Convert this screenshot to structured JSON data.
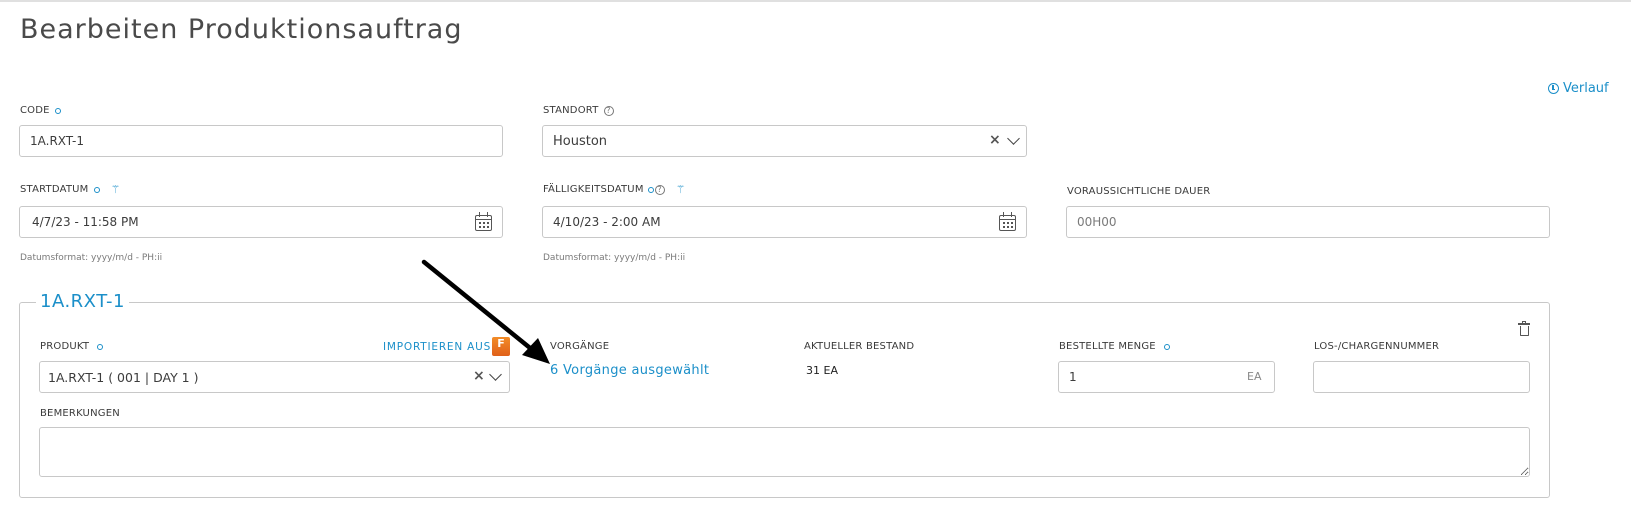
{
  "page_title": "Bearbeiten Produktionsauftrag",
  "history_link": "Verlauf",
  "fields": {
    "code": {
      "label": "CODE",
      "value": "1A.RXT-1"
    },
    "location": {
      "label": "STANDORT",
      "value": "Houston"
    },
    "start_date": {
      "label": "STARTDATUM",
      "value": "4/7/23 - 11:58 PM",
      "hint": "Datumsformat: yyyy/m/d - PH:ii"
    },
    "due_date": {
      "label": "FÄLLIGKEITSDATUM",
      "value": "4/10/23 - 2:00 AM",
      "hint": "Datumsformat: yyyy/m/d - PH:ii"
    },
    "expected_duration": {
      "label": "VORAUSSICHTLICHE DAUER",
      "placeholder": "00H00"
    }
  },
  "section": {
    "title": "1A.RXT-1",
    "product": {
      "label": "PRODUKT",
      "value": "1A.RXT-1 ( 001 | DAY 1 )",
      "import_label": "IMPORTIEREN AUS",
      "import_icon_letter": "F"
    },
    "operations": {
      "label": "VORGÄNGE",
      "value": "6 Vorgänge ausgewählt"
    },
    "current_stock": {
      "label": "AKTUELLER BESTAND",
      "value": "31 EA"
    },
    "ordered_qty": {
      "label": "BESTELLTE MENGE",
      "value": "1",
      "unit": "EA"
    },
    "lot_number": {
      "label": "LOS-/CHARGENNUMMER",
      "value": ""
    },
    "remarks": {
      "label": "BEMERKUNGEN",
      "value": ""
    }
  },
  "colors": {
    "accent": "#1b8fc9",
    "border": "#c8c8c8",
    "import_icon": "#ee7a22"
  },
  "icons": [
    "clock-icon",
    "help-icon",
    "wand-icon",
    "calendar-icon",
    "clear-icon",
    "chevron-down-icon",
    "trash-icon",
    "fishbowl-icon",
    "annotation-arrow"
  ]
}
